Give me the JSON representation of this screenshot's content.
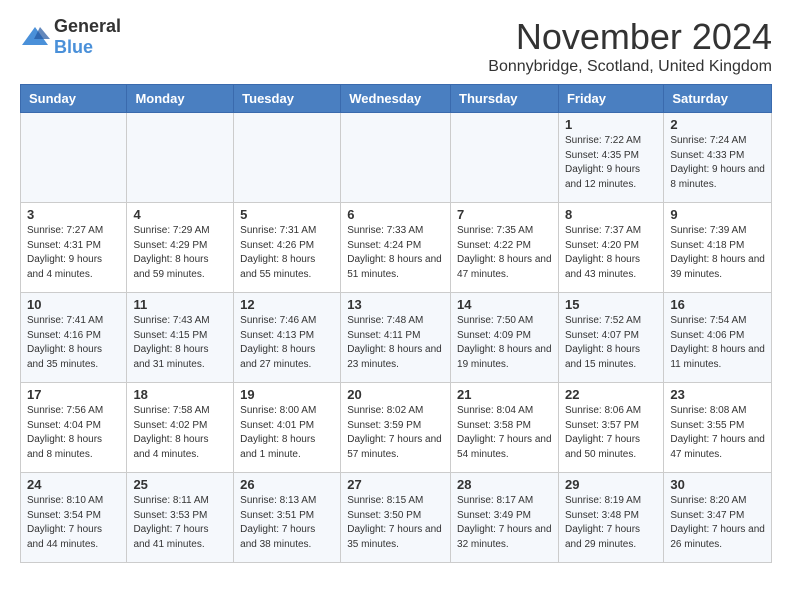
{
  "logo": {
    "text_general": "General",
    "text_blue": "Blue"
  },
  "header": {
    "month_title": "November 2024",
    "subtitle": "Bonnybridge, Scotland, United Kingdom"
  },
  "days_of_week": [
    "Sunday",
    "Monday",
    "Tuesday",
    "Wednesday",
    "Thursday",
    "Friday",
    "Saturday"
  ],
  "weeks": [
    [
      {
        "day": "",
        "info": ""
      },
      {
        "day": "",
        "info": ""
      },
      {
        "day": "",
        "info": ""
      },
      {
        "day": "",
        "info": ""
      },
      {
        "day": "",
        "info": ""
      },
      {
        "day": "1",
        "info": "Sunrise: 7:22 AM\nSunset: 4:35 PM\nDaylight: 9 hours and 12 minutes."
      },
      {
        "day": "2",
        "info": "Sunrise: 7:24 AM\nSunset: 4:33 PM\nDaylight: 9 hours and 8 minutes."
      }
    ],
    [
      {
        "day": "3",
        "info": "Sunrise: 7:27 AM\nSunset: 4:31 PM\nDaylight: 9 hours and 4 minutes."
      },
      {
        "day": "4",
        "info": "Sunrise: 7:29 AM\nSunset: 4:29 PM\nDaylight: 8 hours and 59 minutes."
      },
      {
        "day": "5",
        "info": "Sunrise: 7:31 AM\nSunset: 4:26 PM\nDaylight: 8 hours and 55 minutes."
      },
      {
        "day": "6",
        "info": "Sunrise: 7:33 AM\nSunset: 4:24 PM\nDaylight: 8 hours and 51 minutes."
      },
      {
        "day": "7",
        "info": "Sunrise: 7:35 AM\nSunset: 4:22 PM\nDaylight: 8 hours and 47 minutes."
      },
      {
        "day": "8",
        "info": "Sunrise: 7:37 AM\nSunset: 4:20 PM\nDaylight: 8 hours and 43 minutes."
      },
      {
        "day": "9",
        "info": "Sunrise: 7:39 AM\nSunset: 4:18 PM\nDaylight: 8 hours and 39 minutes."
      }
    ],
    [
      {
        "day": "10",
        "info": "Sunrise: 7:41 AM\nSunset: 4:16 PM\nDaylight: 8 hours and 35 minutes."
      },
      {
        "day": "11",
        "info": "Sunrise: 7:43 AM\nSunset: 4:15 PM\nDaylight: 8 hours and 31 minutes."
      },
      {
        "day": "12",
        "info": "Sunrise: 7:46 AM\nSunset: 4:13 PM\nDaylight: 8 hours and 27 minutes."
      },
      {
        "day": "13",
        "info": "Sunrise: 7:48 AM\nSunset: 4:11 PM\nDaylight: 8 hours and 23 minutes."
      },
      {
        "day": "14",
        "info": "Sunrise: 7:50 AM\nSunset: 4:09 PM\nDaylight: 8 hours and 19 minutes."
      },
      {
        "day": "15",
        "info": "Sunrise: 7:52 AM\nSunset: 4:07 PM\nDaylight: 8 hours and 15 minutes."
      },
      {
        "day": "16",
        "info": "Sunrise: 7:54 AM\nSunset: 4:06 PM\nDaylight: 8 hours and 11 minutes."
      }
    ],
    [
      {
        "day": "17",
        "info": "Sunrise: 7:56 AM\nSunset: 4:04 PM\nDaylight: 8 hours and 8 minutes."
      },
      {
        "day": "18",
        "info": "Sunrise: 7:58 AM\nSunset: 4:02 PM\nDaylight: 8 hours and 4 minutes."
      },
      {
        "day": "19",
        "info": "Sunrise: 8:00 AM\nSunset: 4:01 PM\nDaylight: 8 hours and 1 minute."
      },
      {
        "day": "20",
        "info": "Sunrise: 8:02 AM\nSunset: 3:59 PM\nDaylight: 7 hours and 57 minutes."
      },
      {
        "day": "21",
        "info": "Sunrise: 8:04 AM\nSunset: 3:58 PM\nDaylight: 7 hours and 54 minutes."
      },
      {
        "day": "22",
        "info": "Sunrise: 8:06 AM\nSunset: 3:57 PM\nDaylight: 7 hours and 50 minutes."
      },
      {
        "day": "23",
        "info": "Sunrise: 8:08 AM\nSunset: 3:55 PM\nDaylight: 7 hours and 47 minutes."
      }
    ],
    [
      {
        "day": "24",
        "info": "Sunrise: 8:10 AM\nSunset: 3:54 PM\nDaylight: 7 hours and 44 minutes."
      },
      {
        "day": "25",
        "info": "Sunrise: 8:11 AM\nSunset: 3:53 PM\nDaylight: 7 hours and 41 minutes."
      },
      {
        "day": "26",
        "info": "Sunrise: 8:13 AM\nSunset: 3:51 PM\nDaylight: 7 hours and 38 minutes."
      },
      {
        "day": "27",
        "info": "Sunrise: 8:15 AM\nSunset: 3:50 PM\nDaylight: 7 hours and 35 minutes."
      },
      {
        "day": "28",
        "info": "Sunrise: 8:17 AM\nSunset: 3:49 PM\nDaylight: 7 hours and 32 minutes."
      },
      {
        "day": "29",
        "info": "Sunrise: 8:19 AM\nSunset: 3:48 PM\nDaylight: 7 hours and 29 minutes."
      },
      {
        "day": "30",
        "info": "Sunrise: 8:20 AM\nSunset: 3:47 PM\nDaylight: 7 hours and 26 minutes."
      }
    ]
  ]
}
